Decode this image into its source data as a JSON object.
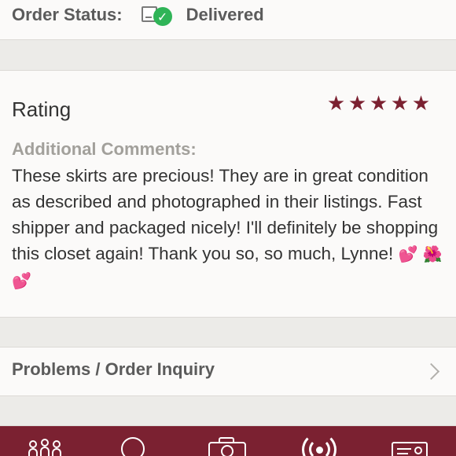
{
  "order": {
    "label": "Order Status:",
    "status_icon": "document-check-icon",
    "status": "Delivered"
  },
  "rating": {
    "title": "Rating",
    "stars": 5,
    "max_stars": 5,
    "star_color": "#7b2131"
  },
  "comments": {
    "label": "Additional Comments:",
    "text": "These skirts are precious! They are in great condition as described and photographed in their listings. Fast shipper and packaged nicely! I'll definitely be shopping this closet again! Thank you so, so much, Lynne!",
    "emoji": [
      "💕",
      "🌺",
      "💕"
    ]
  },
  "problems": {
    "label": "Problems / Order Inquiry",
    "icon": "chevron-right-icon"
  },
  "tabbar": {
    "background": "#7b2131",
    "tabs": [
      {
        "icon": "community-icon"
      },
      {
        "icon": "circle-icon"
      },
      {
        "icon": "camera-icon"
      },
      {
        "icon": "broadcast-icon"
      },
      {
        "icon": "account-card-icon"
      }
    ]
  }
}
